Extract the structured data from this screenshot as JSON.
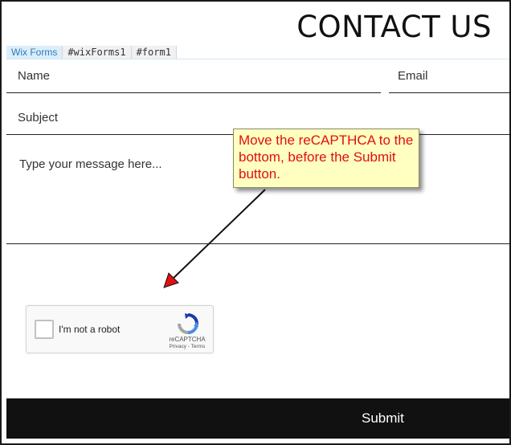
{
  "page": {
    "title": "CONTACT US"
  },
  "tabs": [
    {
      "label": "Wix Forms"
    },
    {
      "label": "#wixForms1"
    },
    {
      "label": "#form1"
    }
  ],
  "form": {
    "name_label": "Name",
    "email_label": "Email",
    "subject_label": "Subject",
    "message_placeholder": "Type your message here...",
    "submit_label": "Submit"
  },
  "recaptcha": {
    "checkbox_label": "I'm not a robot",
    "brand": "reCAPTCHA",
    "links": "Privacy - Terms"
  },
  "annotation": {
    "text": "Move the reCAPTHCA to the bottom, before the Submit button."
  },
  "colors": {
    "submit_bg": "#111111",
    "callout_bg": "#ffffc0",
    "callout_text": "#e01010",
    "arrow_head": "#e01010"
  }
}
